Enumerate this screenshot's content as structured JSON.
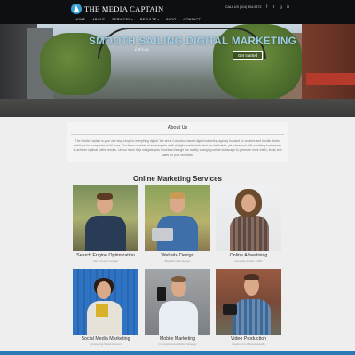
{
  "header": {
    "logo_text": "THE MEDIA CAPTAIN",
    "contact": "CALL US (614) 804-9373",
    "social_icons": [
      "facebook-icon",
      "twitter-icon",
      "google-plus-icon",
      "linkedin-icon"
    ],
    "social_glyphs": [
      "f",
      "t",
      "g",
      "in"
    ],
    "nav": [
      "HOME",
      "ABOUT",
      "SERVICES",
      "RESULTS",
      "BLOG",
      "CONTACT"
    ]
  },
  "hero": {
    "title": "SMOOTH SAILING DIGITAL MARKETING",
    "script": "Let's go",
    "button": "Get started"
  },
  "about": {
    "title": "About Us",
    "text": "The Media Captain is your one stop shop for everything digital. We are a Columbus based digital marketing agency focused on creative and results driven solutions for companies of all sizes. Our team consists of an energetic staff of digital enthusiasts that are dedicated, yet, obsessed with assisting businesses to achieve optimal online results. Let our team help navigate your business through the rapidly changing online landscape to generate more traffic, leads and sales for your business."
  },
  "services": {
    "title": "Online Marketing Services",
    "items": [
      {
        "title": "Search Engine Optimization",
        "sub": "Get Found in Google"
      },
      {
        "title": "Website Design",
        "sub": "Beautiful Web Design"
      },
      {
        "title": "Online Advertising",
        "sub": "Generate Instant Traffic"
      },
      {
        "title": "Social Media Marketing",
        "sub": "Compelling Social Content"
      },
      {
        "title": "Mobile Marketing",
        "sub": "Comprehensive Mobile Strategy"
      },
      {
        "title": "Video Production",
        "sub": "Capture Your Brand Visually"
      }
    ]
  },
  "colors": {
    "header_bg": "#0e0f12",
    "hero_title": "#9fd0ea",
    "accent_blue": "#2d79b5",
    "page_bg": "#eeeeee"
  }
}
